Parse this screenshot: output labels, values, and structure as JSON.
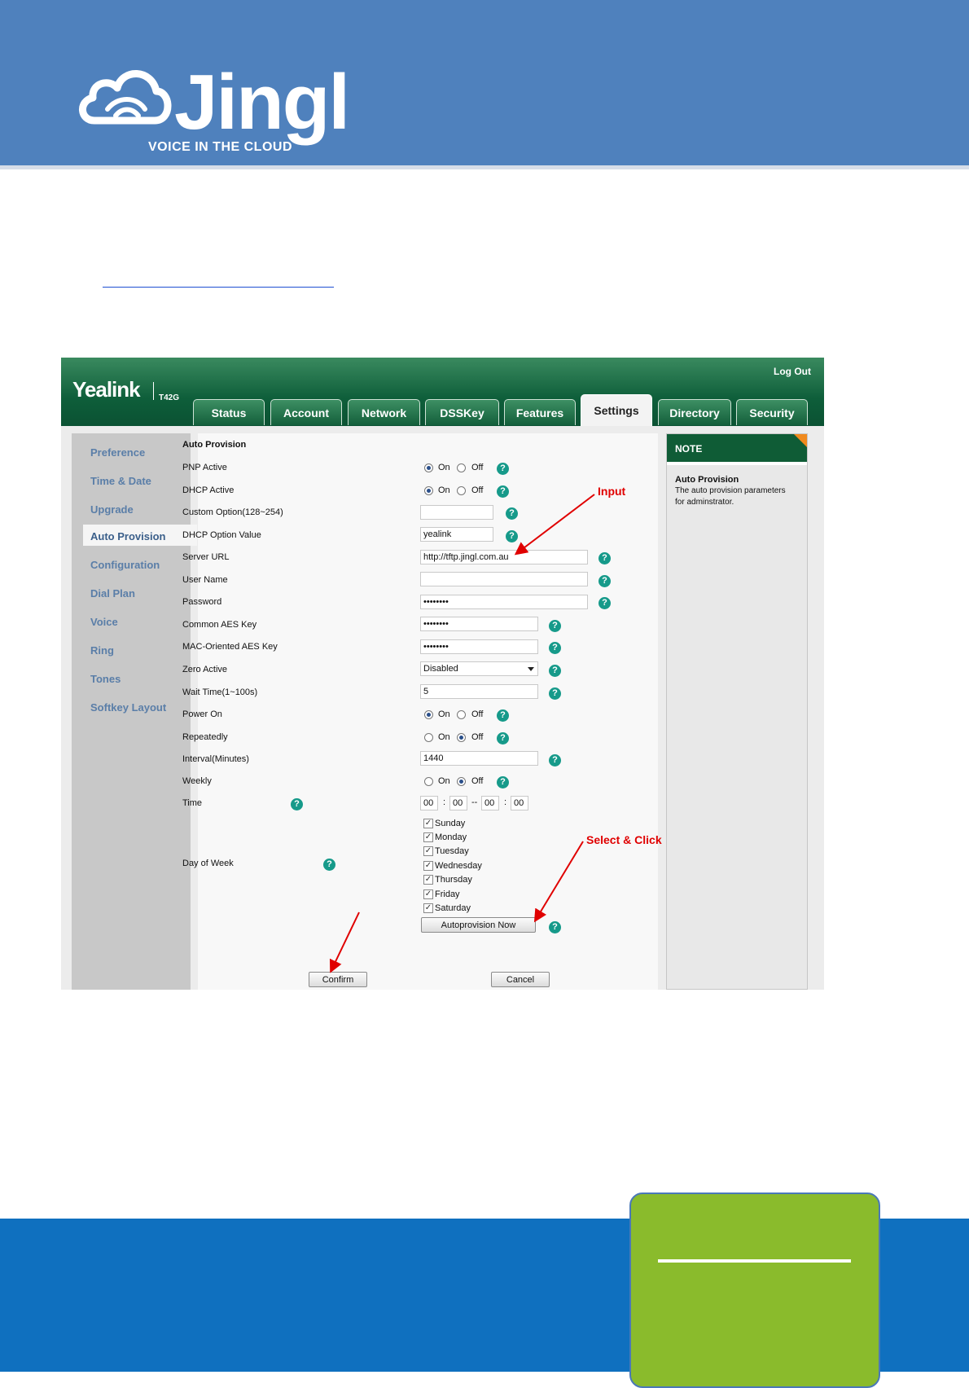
{
  "banner": {
    "logo_text": "Jingl",
    "tagline": "VOICE IN THE CLOUD"
  },
  "phone_ui": {
    "brand": "Yealink",
    "model": "T42G",
    "logout": "Log Out",
    "tabs": [
      "Status",
      "Account",
      "Network",
      "DSSKey",
      "Features",
      "Settings",
      "Directory",
      "Security"
    ],
    "active_tab": "Settings",
    "sidebar": [
      "Preference",
      "Time & Date",
      "Upgrade",
      "Auto Provision",
      "Configuration",
      "Dial Plan",
      "Voice",
      "Ring",
      "Tones",
      "Softkey Layout"
    ],
    "active_sidebar": "Auto Provision",
    "section_title": "Auto Provision",
    "fields": {
      "pnp_active": "PNP Active",
      "dhcp_active": "DHCP Active",
      "custom_option": "Custom Option(128~254)",
      "dhcp_option_value": "DHCP Option Value",
      "server_url": "Server URL",
      "user_name": "User Name",
      "password": "Password",
      "common_aes_key": "Common AES Key",
      "mac_aes_key": "MAC-Oriented AES Key",
      "zero_active": "Zero Active",
      "wait_time": "Wait Time(1~100s)",
      "power_on": "Power On",
      "repeatedly": "Repeatedly",
      "interval": "Interval(Minutes)",
      "weekly": "Weekly",
      "time": "Time",
      "day_of_week": "Day of Week"
    },
    "values": {
      "custom_option": "",
      "dhcp_option_value": "yealink",
      "server_url": "http://tftp.jingl.com.au",
      "user_name": "",
      "password": "••••••••",
      "common_aes_key": "••••••••",
      "mac_aes_key": "••••••••",
      "zero_active": "Disabled",
      "wait_time": "5",
      "interval": "1440",
      "time_start_h": "00",
      "time_start_m": "00",
      "time_end_h": "00",
      "time_end_m": "00"
    },
    "on_label": "On",
    "off_label": "Off",
    "radio_state": {
      "pnp_active": "On",
      "dhcp_active": "On",
      "power_on": "On",
      "repeatedly": "Off",
      "weekly": "Off"
    },
    "time_sep_colon": ":",
    "time_sep_dash": "--",
    "days": [
      "Sunday",
      "Monday",
      "Tuesday",
      "Wednesday",
      "Thursday",
      "Friday",
      "Saturday"
    ],
    "days_checked": [
      true,
      true,
      true,
      true,
      true,
      true,
      true
    ],
    "autoprovision_button": "Autoprovision Now",
    "confirm_button": "Confirm",
    "cancel_button": "Cancel",
    "help_glyph": "?",
    "note": {
      "header": "NOTE",
      "title": "Auto Provision",
      "text_line1": "The auto provision parameters",
      "text_line2": "for adminstrator."
    }
  },
  "annotations": {
    "input": "Input",
    "select_click": "Select & Click"
  },
  "colors": {
    "banner": "#4f81bd",
    "footer": "#0f70bf",
    "green_box": "#8abb2c",
    "yealink_green": "#0f5c36",
    "annotation_red": "#e00000"
  }
}
